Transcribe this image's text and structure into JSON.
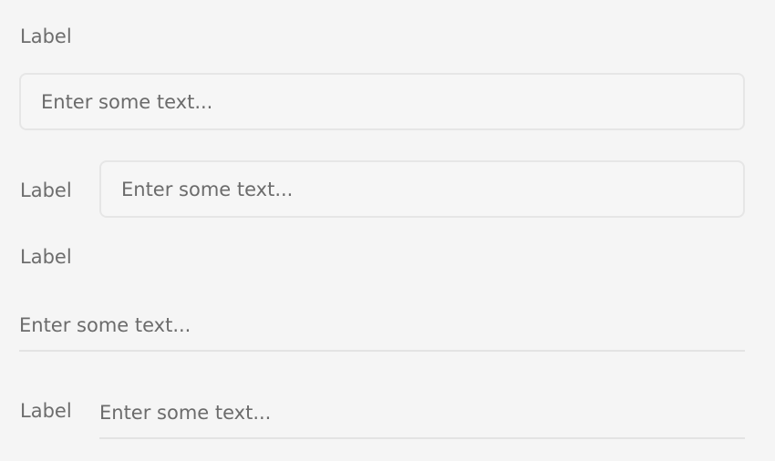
{
  "fields": [
    {
      "label": "Label",
      "placeholder": "Enter some text...",
      "style": "boxed",
      "label_position": "top"
    },
    {
      "label": "Label",
      "placeholder": "Enter some text...",
      "style": "boxed",
      "label_position": "inline"
    },
    {
      "label": "Label",
      "placeholder": "Enter some text...",
      "style": "underlined",
      "label_position": "top"
    },
    {
      "label": "Label",
      "placeholder": "Enter some text...",
      "style": "underlined",
      "label_position": "inline"
    }
  ]
}
